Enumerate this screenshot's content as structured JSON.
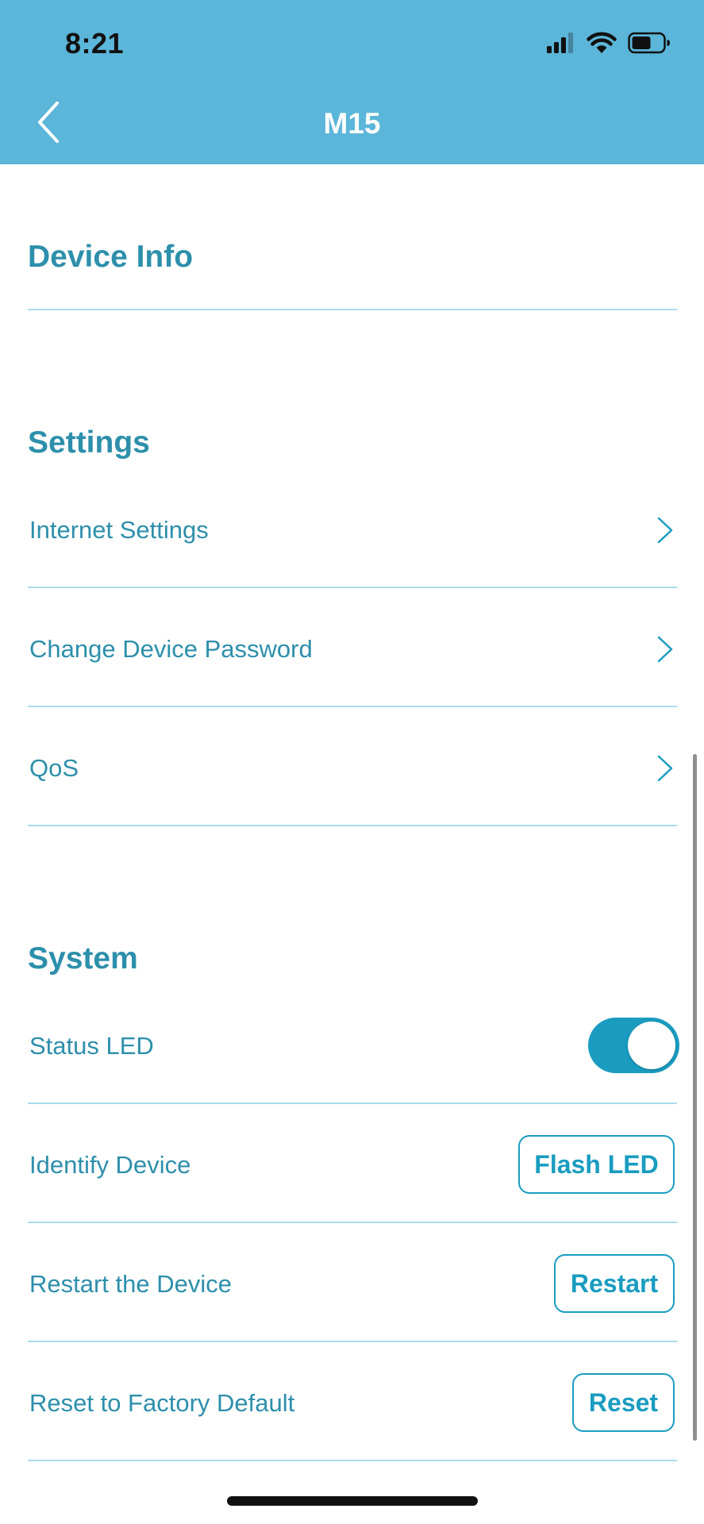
{
  "status_bar": {
    "time": "8:21",
    "icons": [
      "cellular-signal-icon",
      "wifi-icon",
      "battery-icon"
    ]
  },
  "header": {
    "back_icon": "chevron-left-icon",
    "title": "M15",
    "background": "#5BB6D9"
  },
  "sections": {
    "device_info": {
      "title": "Device Info"
    },
    "settings": {
      "title": "Settings",
      "items": [
        {
          "label": "Internet Settings",
          "icon": "chevron-right-icon"
        },
        {
          "label": "Change Device Password",
          "icon": "chevron-right-icon"
        },
        {
          "label": "QoS",
          "icon": "chevron-right-icon"
        }
      ]
    },
    "system": {
      "title": "System",
      "status_led": {
        "label": "Status LED",
        "enabled": true
      },
      "identify": {
        "label": "Identify Device",
        "button": "Flash LED"
      },
      "restart": {
        "label": "Restart the Device",
        "button": "Restart"
      },
      "reset": {
        "label": "Reset to Factory Default",
        "button": "Reset"
      }
    }
  },
  "colors": {
    "accent": "#1A9CC0",
    "text": "#2D8FAB",
    "divider": "#A8DCEA"
  }
}
